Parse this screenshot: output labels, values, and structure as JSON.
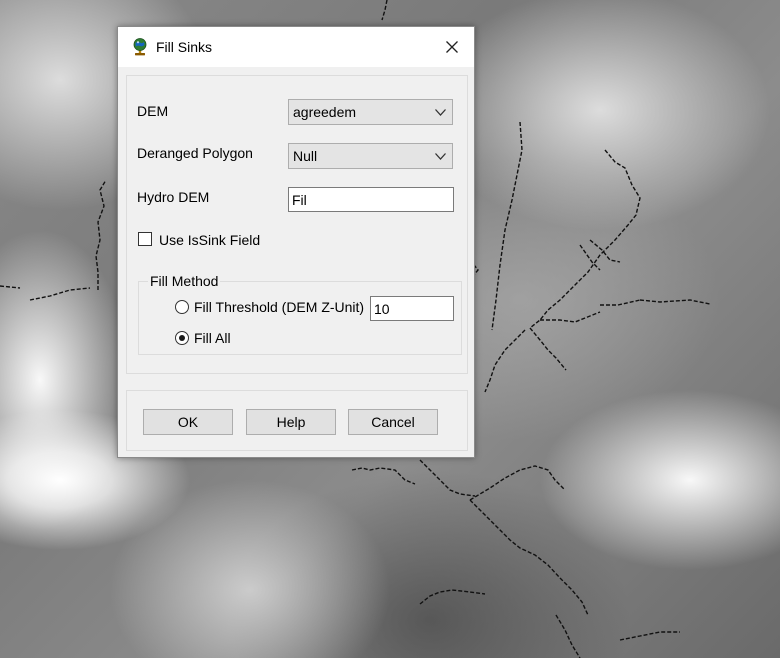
{
  "window": {
    "title": "Fill Sinks",
    "icon": "arc-globe-icon"
  },
  "form": {
    "dem": {
      "label": "DEM",
      "value": "agreedem"
    },
    "deranged_polygon": {
      "label": "Deranged Polygon",
      "value": "Null"
    },
    "hydro_dem": {
      "label": "Hydro DEM",
      "value": "Fil"
    },
    "use_issink": {
      "label": "Use IsSink Field",
      "checked": false
    }
  },
  "fill_method": {
    "title": "Fill Method",
    "threshold": {
      "label": "Fill Threshold (DEM Z-Unit)",
      "value": "10",
      "selected": false
    },
    "fill_all": {
      "label": "Fill All",
      "selected": true
    }
  },
  "buttons": {
    "ok": "OK",
    "help": "Help",
    "cancel": "Cancel"
  },
  "colors": {
    "dialog_bg": "#f0f0f0",
    "titlebar_bg": "#ffffff",
    "button_bg": "#e1e1e1"
  }
}
